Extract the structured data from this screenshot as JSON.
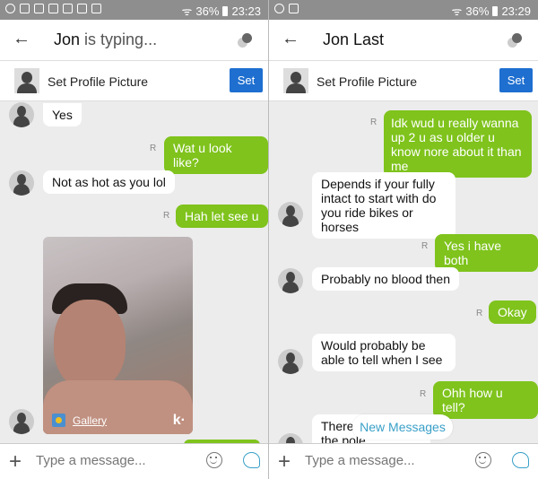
{
  "left": {
    "status": {
      "battery": "36%",
      "time": "23:23"
    },
    "header": {
      "name": "Jon",
      "typing": " is typing..."
    },
    "profile": {
      "label": "Set Profile Picture",
      "button": "Set"
    },
    "messages": [
      {
        "dir": "in",
        "text": "Yes"
      },
      {
        "dir": "out",
        "text": "Wat u look like?",
        "receipt": "R"
      },
      {
        "dir": "in",
        "text": "Not as hot as you lol"
      },
      {
        "dir": "out",
        "text": "Hah let see u",
        "receipt": "R"
      },
      {
        "dir": "in",
        "type": "photo",
        "source": "Gallery",
        "badge": "k·"
      }
    ],
    "input": {
      "placeholder": "Type a message..."
    }
  },
  "right": {
    "status": {
      "battery": "36%",
      "time": "23:29"
    },
    "header": {
      "name": "Jon Last"
    },
    "profile": {
      "label": "Set Profile Picture",
      "button": "Set"
    },
    "messages": [
      {
        "dir": "out",
        "text": "Idk wud u really wanna up 2 u as u older u know nore about it than me",
        "receipt": "R"
      },
      {
        "dir": "in",
        "text": "Depends if your fully intact to start with do you ride bikes or horses"
      },
      {
        "dir": "out",
        "text": "Yes i have both",
        "receipt": "R"
      },
      {
        "dir": "in",
        "text": "Probably no blood then"
      },
      {
        "dir": "out",
        "text": "Okay",
        "receipt": "R"
      },
      {
        "dir": "in",
        "text": "Would probably be able to tell when I see"
      },
      {
        "dir": "out",
        "text": "Ohh how u tell?",
        "receipt": "R"
      },
      {
        "dir": "in",
        "text": "There ... covering the pole"
      }
    ],
    "new_messages": "New Messages",
    "input": {
      "placeholder": "Type a message..."
    }
  },
  "colors": {
    "accent": "#1e6fd0",
    "outgoing": "#7fc31c",
    "new_messages": "#3aa0c8"
  }
}
